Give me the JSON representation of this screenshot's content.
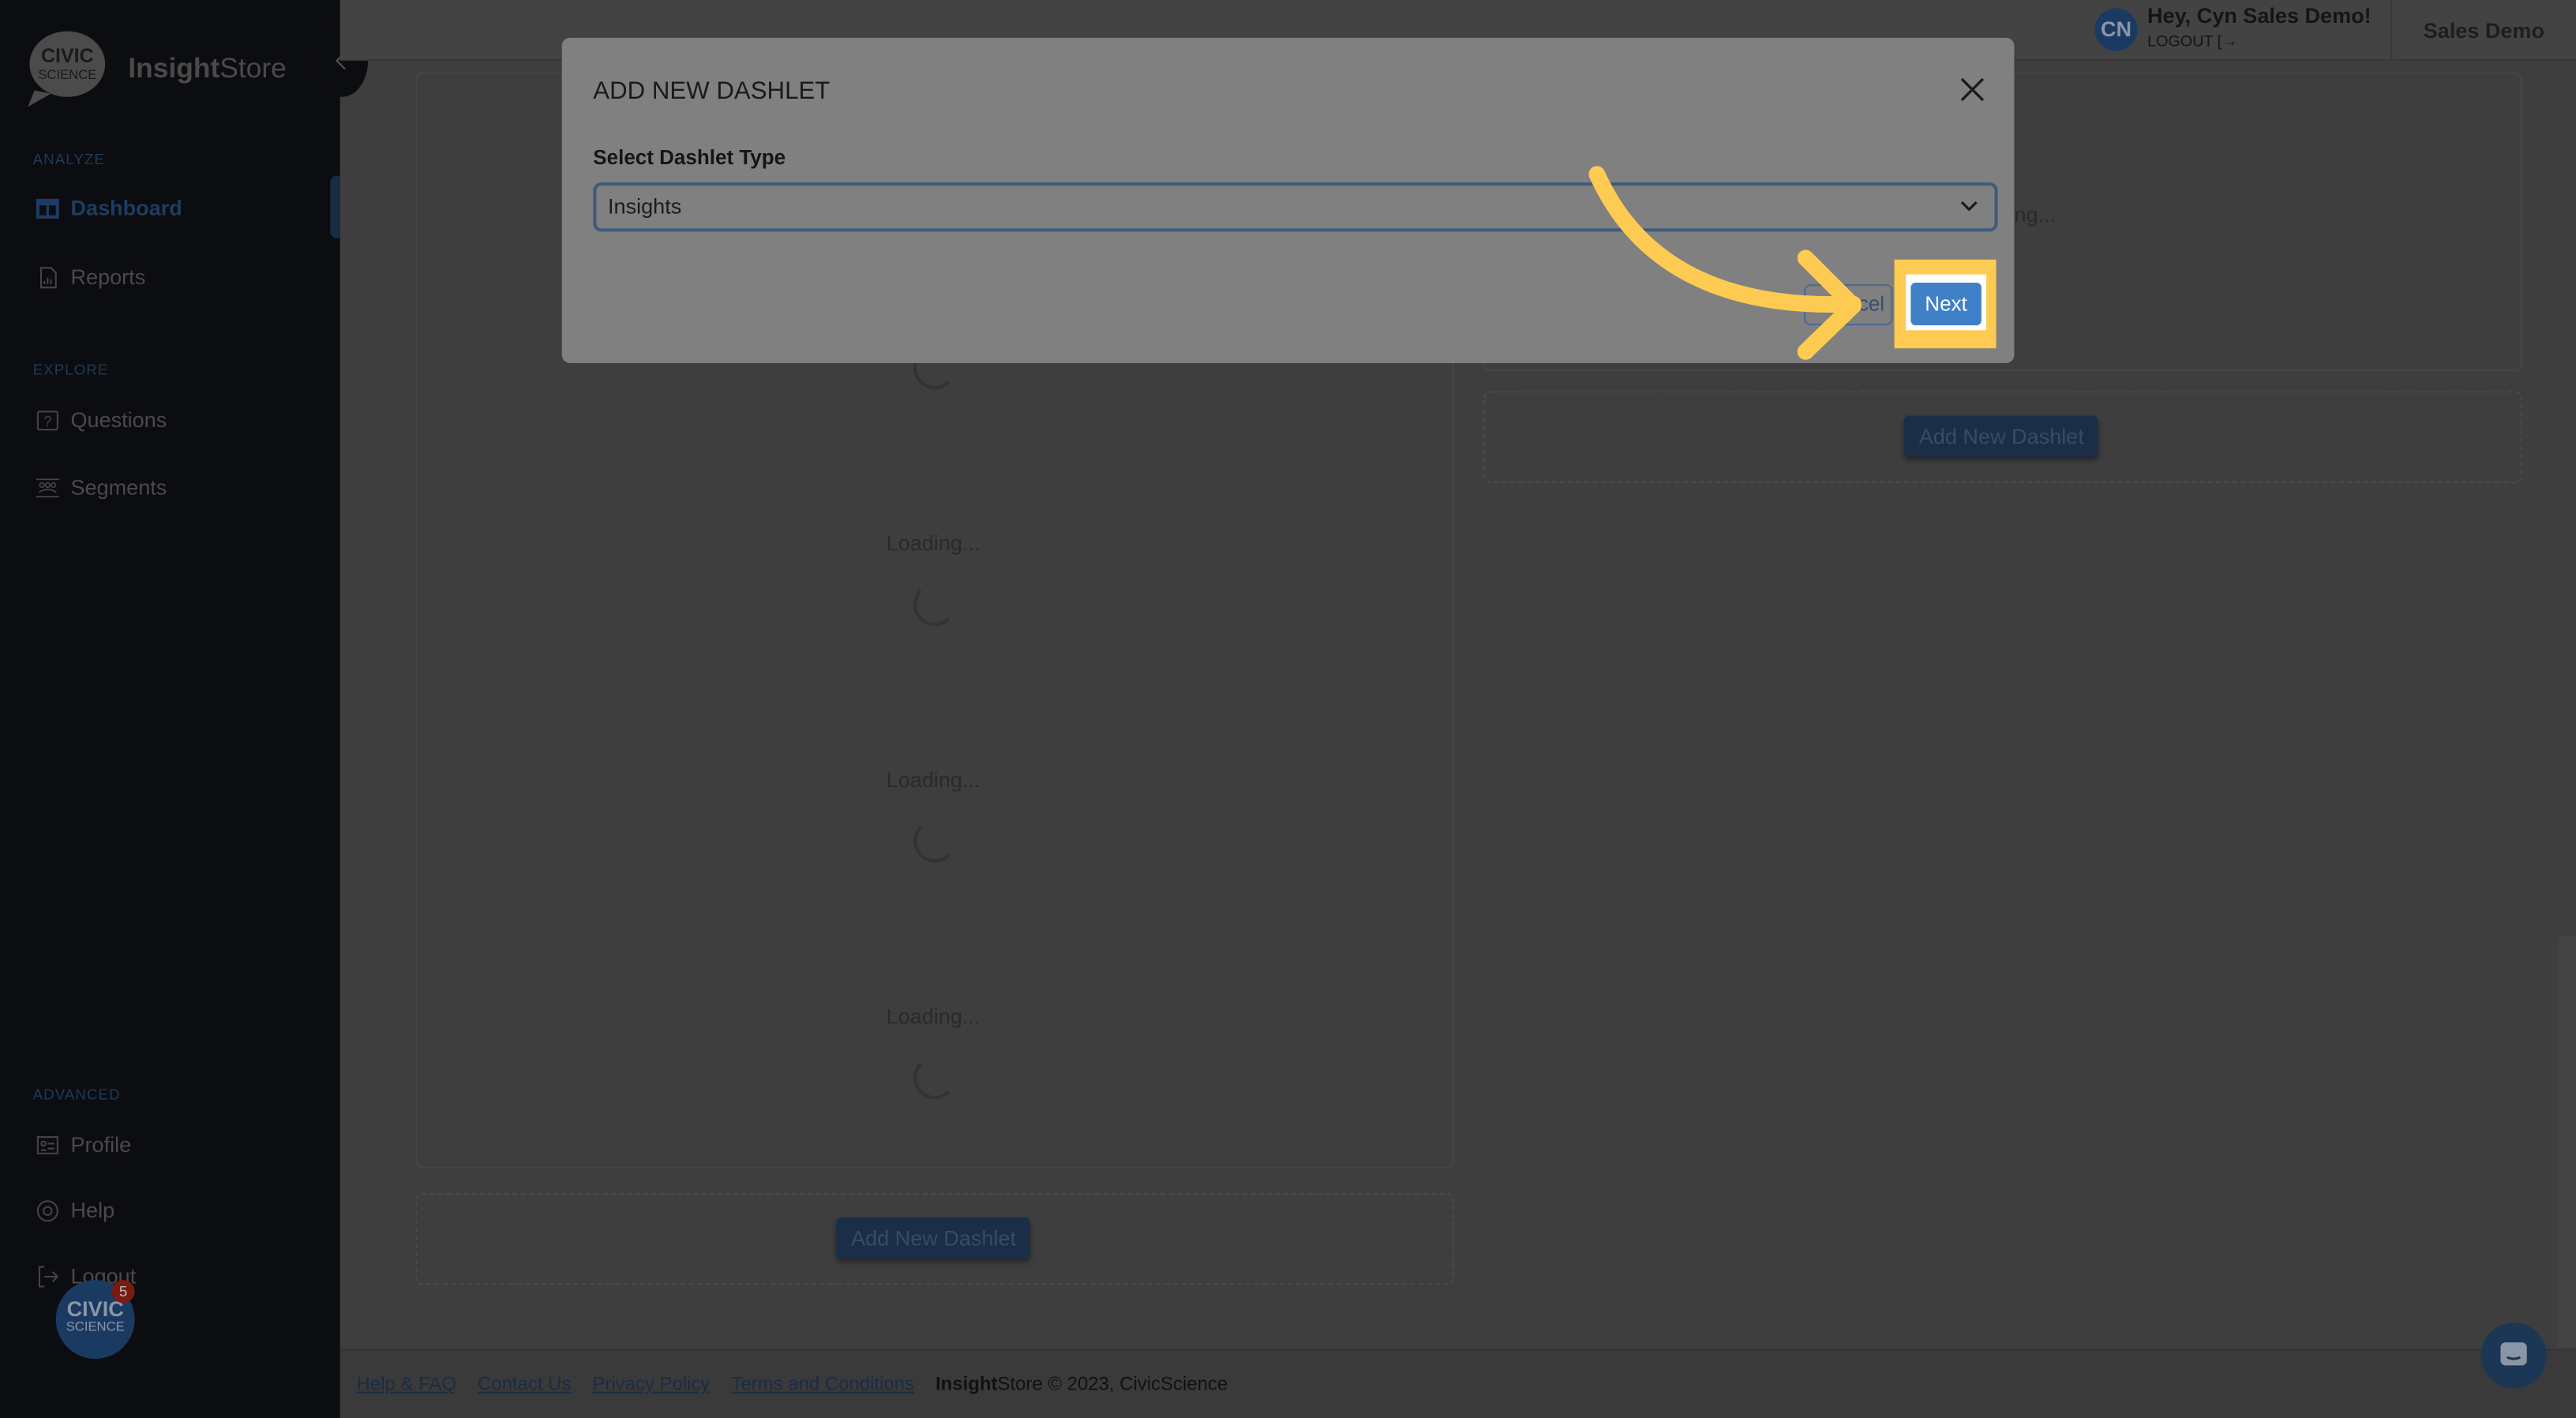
{
  "brand": {
    "logo_text_top": "CIVIC",
    "logo_text_bottom": "SCIENCE",
    "name_bold": "Insight",
    "name_rest": "Store"
  },
  "sidebar": {
    "sections": [
      {
        "label": "ANALYZE",
        "items": [
          {
            "label": "Dashboard",
            "icon": "dashboard-icon",
            "active": true
          },
          {
            "label": "Reports",
            "icon": "report-icon"
          }
        ]
      },
      {
        "label": "EXPLORE",
        "items": [
          {
            "label": "Questions",
            "icon": "question-icon"
          },
          {
            "label": "Segments",
            "icon": "segments-icon"
          }
        ]
      },
      {
        "label": "ADVANCED",
        "items": [
          {
            "label": "Profile",
            "icon": "profile-icon"
          },
          {
            "label": "Help",
            "icon": "help-icon"
          },
          {
            "label": "Logout",
            "icon": "logout-icon"
          }
        ]
      }
    ],
    "badge_count": "5"
  },
  "header": {
    "avatar_initials": "CN",
    "greeting": "Hey, Cyn Sales Demo!",
    "logout": "LOGOUT",
    "account": "Sales Demo"
  },
  "main": {
    "loading_text": "Loading...",
    "partial_loading_text": "ng...",
    "add_dashlet_label": "Add New Dashlet"
  },
  "modal": {
    "title": "ADD NEW DASHLET",
    "field_label": "Select Dashlet Type",
    "selected_value": "Insights",
    "cancel_label": "Cancel",
    "cancel_visible": "cel",
    "next_label": "Next"
  },
  "footer": {
    "links": [
      "Help & FAQ",
      "Contact Us",
      "Privacy Policy",
      "Terms and Conditions"
    ],
    "copy_bold": "Insight",
    "copy_rest": "Store © 2023, CivicScience"
  },
  "colors": {
    "accent": "#3f80c8",
    "highlight": "#fecb52",
    "sidebar_bg": "#0c0d10"
  }
}
